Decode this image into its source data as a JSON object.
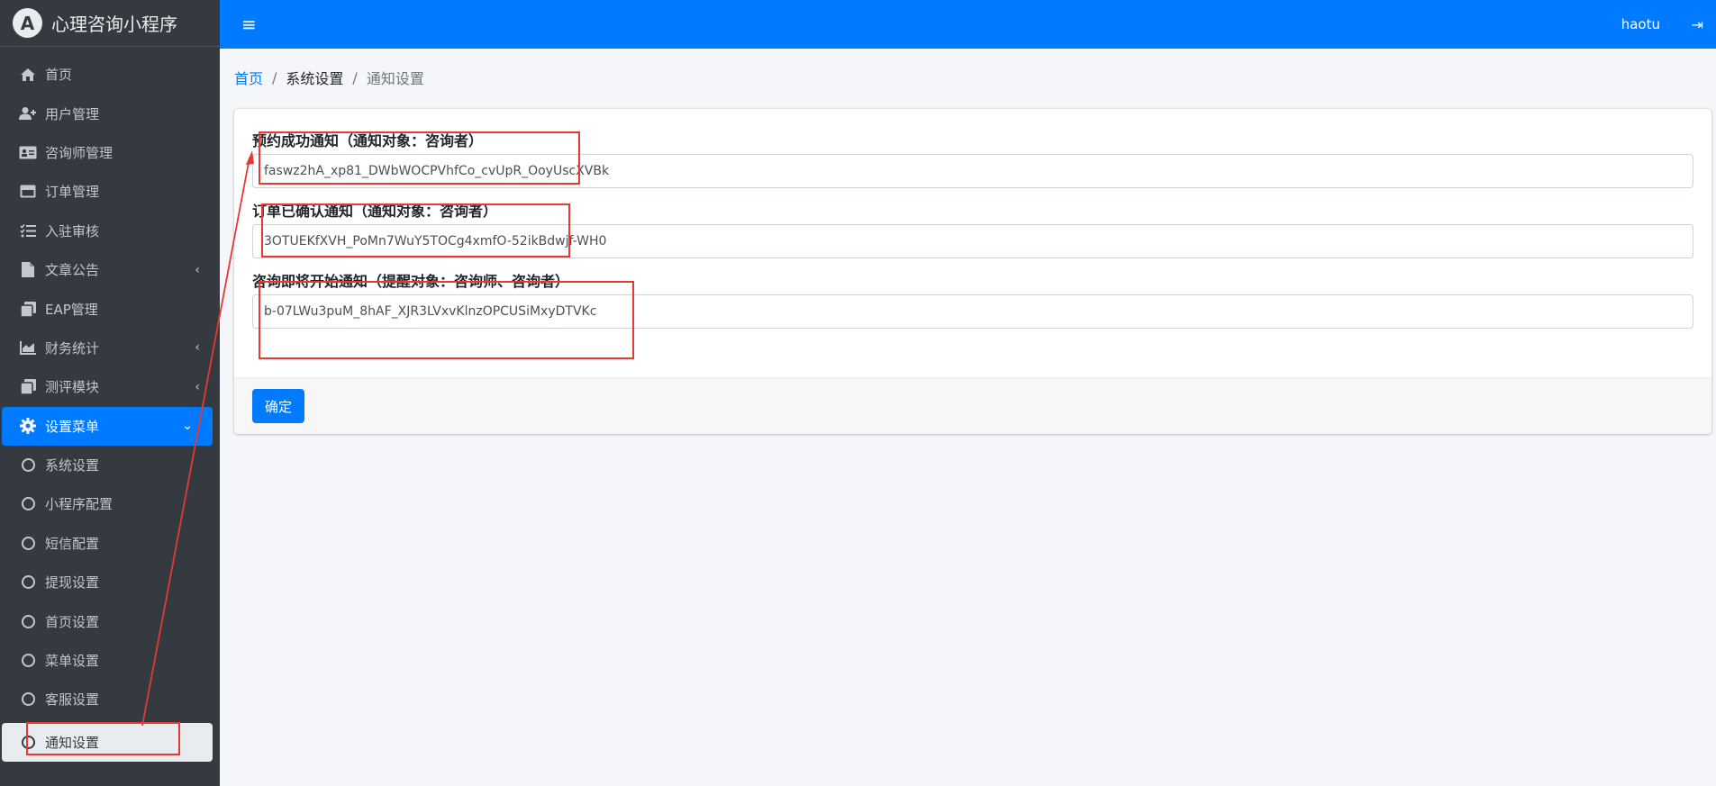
{
  "brand": {
    "logo_letter": "A",
    "title": "心理咨询小程序"
  },
  "sidebar": {
    "items": [
      {
        "label": "首页",
        "icon": "home-icon"
      },
      {
        "label": "用户管理",
        "icon": "user-plus-icon"
      },
      {
        "label": "咨询师管理",
        "icon": "id-card-icon"
      },
      {
        "label": "订单管理",
        "icon": "card-icon"
      },
      {
        "label": "入驻审核",
        "icon": "tasks-icon"
      },
      {
        "label": "文章公告",
        "icon": "file-icon",
        "caret": "‹"
      },
      {
        "label": "EAP管理",
        "icon": "clone-icon"
      },
      {
        "label": "财务统计",
        "icon": "chart-area-icon",
        "caret": "‹"
      },
      {
        "label": "测评模块",
        "icon": "clone-icon",
        "caret": "‹"
      },
      {
        "label": "设置菜单",
        "icon": "gear-icon",
        "caret": "⌄"
      }
    ],
    "subitems": [
      {
        "label": "系统设置"
      },
      {
        "label": "小程序配置"
      },
      {
        "label": "短信配置"
      },
      {
        "label": "提现设置"
      },
      {
        "label": "首页设置"
      },
      {
        "label": "菜单设置"
      },
      {
        "label": "客服设置"
      },
      {
        "label": "通知设置"
      }
    ]
  },
  "topbar": {
    "menu_icon": "≡",
    "username": "haotu",
    "logout_icon": "⇥"
  },
  "breadcrumb": {
    "home": "首页",
    "sep": "/",
    "mid": "系统设置",
    "current": "通知设置"
  },
  "form": {
    "fields": [
      {
        "label": "预约成功通知（通知对象：咨询者）",
        "value": "faswz2hA_xp81_DWbWOCPVhfCo_cvUpR_OoyUscXVBk"
      },
      {
        "label": "订单已确认通知（通知对象：咨询者）",
        "value": "3OTUEKfXVH_PoMn7WuY5TOCg4xmfO-52ikBdwjf-WH0"
      },
      {
        "label": "咨询即将开始通知（提醒对象：咨询师、咨询者）",
        "value": "b-07LWu3puM_8hAF_XJR3LVxvKlnzOPCUSiMxyDTVKc"
      }
    ],
    "submit_label": "确定"
  },
  "colors": {
    "primary": "#007bff",
    "sidebar": "#343a40",
    "annotation": "#e53935"
  }
}
